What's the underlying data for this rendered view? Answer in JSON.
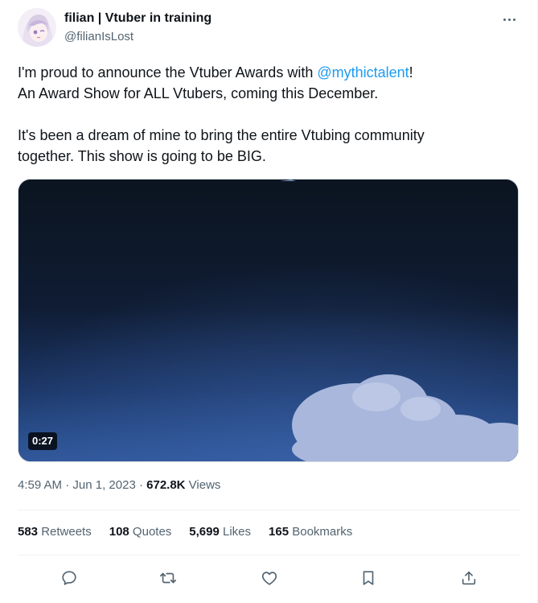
{
  "author": {
    "display_name": "filian | Vtuber in training",
    "handle": "@filianIsLost"
  },
  "tweet": {
    "line1_pre": "I'm proud to announce the Vtuber Awards with ",
    "mention": "@mythictalent",
    "line1_post": "!",
    "line2": "An Award Show for ALL Vtubers, coming this December.",
    "line3": "It's been a dream of mine to bring the entire Vtubing community",
    "line4": "together. This show is going to be BIG."
  },
  "media": {
    "duration": "0:27"
  },
  "meta": {
    "time": "4:59 AM",
    "sep1": " · ",
    "date": "Jun 1, 2023",
    "sep2": " · ",
    "views_count": "672.8K",
    "views_label": " Views"
  },
  "stats": {
    "retweets_count": "583",
    "retweets_label": " Retweets",
    "quotes_count": "108",
    "quotes_label": " Quotes",
    "likes_count": "5,699",
    "likes_label": " Likes",
    "bookmarks_count": "165",
    "bookmarks_label": " Bookmarks"
  },
  "icons": {
    "more": "more-horizontal-icon",
    "reply": "reply-icon",
    "retweet": "retweet-icon",
    "like": "heart-icon",
    "bookmark": "bookmark-icon",
    "share": "share-icon"
  },
  "colors": {
    "link": "#1d9bf0",
    "text": "#0f1419",
    "secondary": "#536471",
    "icon": "#536471"
  }
}
